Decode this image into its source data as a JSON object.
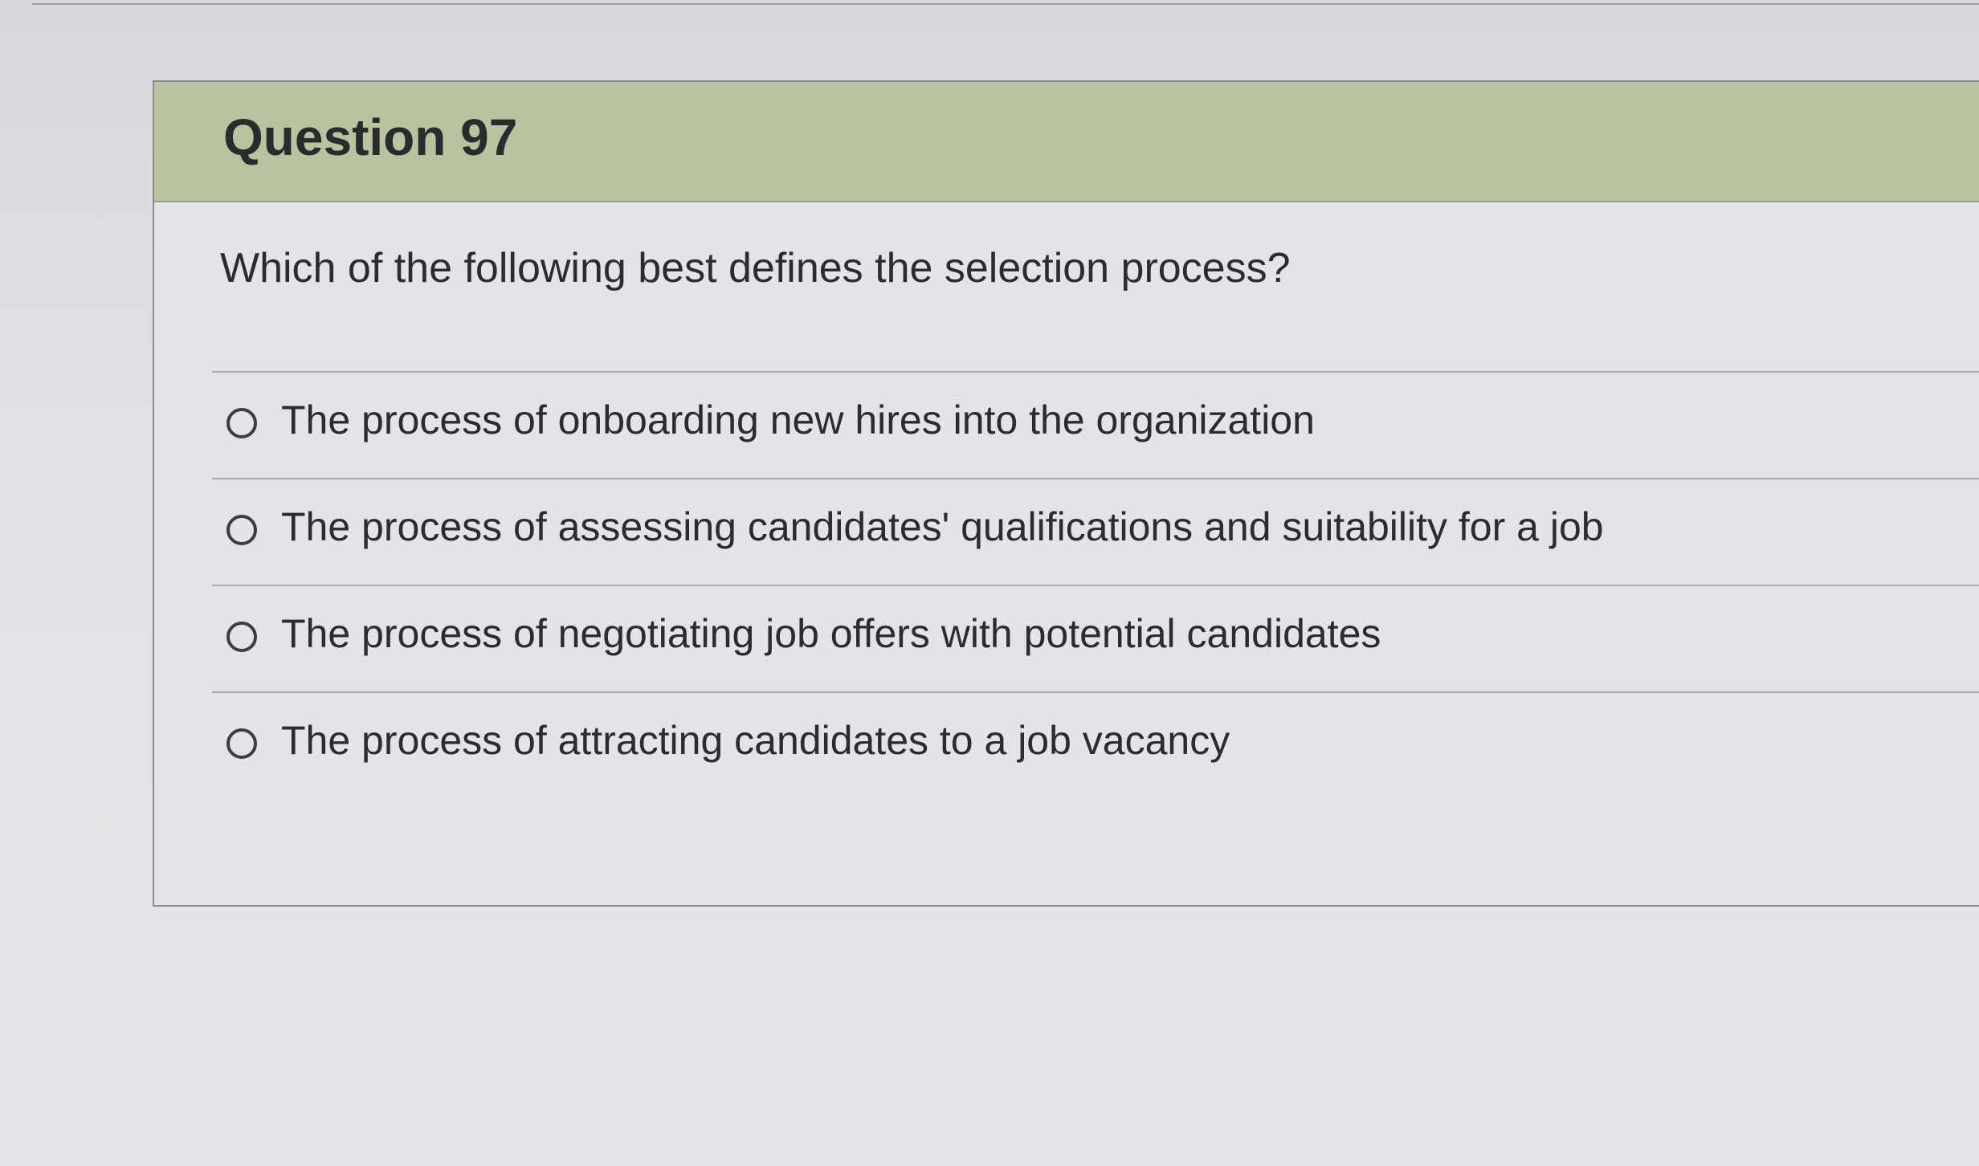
{
  "question": {
    "title": "Question 97",
    "prompt": "Which of the following best defines the selection process?",
    "options": [
      {
        "label": "The process of onboarding new hires into the organization"
      },
      {
        "label": "The process of assessing candidates' qualifications and suitability for a job"
      },
      {
        "label": "The process of negotiating job offers with potential candidates"
      },
      {
        "label": "The process of attracting candidates to a job vacancy"
      }
    ]
  },
  "colors": {
    "header_bg": "#b7c49f",
    "card_bg": "#e3e4e7",
    "text": "#2b2c2e"
  }
}
